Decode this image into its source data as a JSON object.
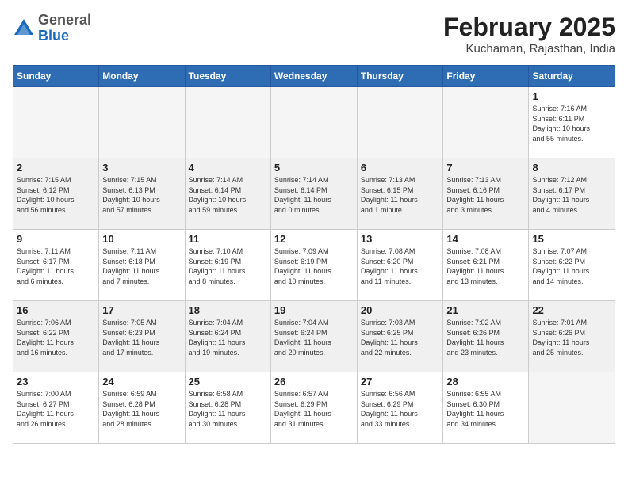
{
  "header": {
    "logo_general": "General",
    "logo_blue": "Blue",
    "title": "February 2025",
    "subtitle": "Kuchaman, Rajasthan, India"
  },
  "weekdays": [
    "Sunday",
    "Monday",
    "Tuesday",
    "Wednesday",
    "Thursday",
    "Friday",
    "Saturday"
  ],
  "weeks": [
    {
      "shaded": false,
      "days": [
        {
          "num": "",
          "info": ""
        },
        {
          "num": "",
          "info": ""
        },
        {
          "num": "",
          "info": ""
        },
        {
          "num": "",
          "info": ""
        },
        {
          "num": "",
          "info": ""
        },
        {
          "num": "",
          "info": ""
        },
        {
          "num": "1",
          "info": "Sunrise: 7:16 AM\nSunset: 6:11 PM\nDaylight: 10 hours\nand 55 minutes."
        }
      ]
    },
    {
      "shaded": true,
      "days": [
        {
          "num": "2",
          "info": "Sunrise: 7:15 AM\nSunset: 6:12 PM\nDaylight: 10 hours\nand 56 minutes."
        },
        {
          "num": "3",
          "info": "Sunrise: 7:15 AM\nSunset: 6:13 PM\nDaylight: 10 hours\nand 57 minutes."
        },
        {
          "num": "4",
          "info": "Sunrise: 7:14 AM\nSunset: 6:14 PM\nDaylight: 10 hours\nand 59 minutes."
        },
        {
          "num": "5",
          "info": "Sunrise: 7:14 AM\nSunset: 6:14 PM\nDaylight: 11 hours\nand 0 minutes."
        },
        {
          "num": "6",
          "info": "Sunrise: 7:13 AM\nSunset: 6:15 PM\nDaylight: 11 hours\nand 1 minute."
        },
        {
          "num": "7",
          "info": "Sunrise: 7:13 AM\nSunset: 6:16 PM\nDaylight: 11 hours\nand 3 minutes."
        },
        {
          "num": "8",
          "info": "Sunrise: 7:12 AM\nSunset: 6:17 PM\nDaylight: 11 hours\nand 4 minutes."
        }
      ]
    },
    {
      "shaded": false,
      "days": [
        {
          "num": "9",
          "info": "Sunrise: 7:11 AM\nSunset: 6:17 PM\nDaylight: 11 hours\nand 6 minutes."
        },
        {
          "num": "10",
          "info": "Sunrise: 7:11 AM\nSunset: 6:18 PM\nDaylight: 11 hours\nand 7 minutes."
        },
        {
          "num": "11",
          "info": "Sunrise: 7:10 AM\nSunset: 6:19 PM\nDaylight: 11 hours\nand 8 minutes."
        },
        {
          "num": "12",
          "info": "Sunrise: 7:09 AM\nSunset: 6:19 PM\nDaylight: 11 hours\nand 10 minutes."
        },
        {
          "num": "13",
          "info": "Sunrise: 7:08 AM\nSunset: 6:20 PM\nDaylight: 11 hours\nand 11 minutes."
        },
        {
          "num": "14",
          "info": "Sunrise: 7:08 AM\nSunset: 6:21 PM\nDaylight: 11 hours\nand 13 minutes."
        },
        {
          "num": "15",
          "info": "Sunrise: 7:07 AM\nSunset: 6:22 PM\nDaylight: 11 hours\nand 14 minutes."
        }
      ]
    },
    {
      "shaded": true,
      "days": [
        {
          "num": "16",
          "info": "Sunrise: 7:06 AM\nSunset: 6:22 PM\nDaylight: 11 hours\nand 16 minutes."
        },
        {
          "num": "17",
          "info": "Sunrise: 7:05 AM\nSunset: 6:23 PM\nDaylight: 11 hours\nand 17 minutes."
        },
        {
          "num": "18",
          "info": "Sunrise: 7:04 AM\nSunset: 6:24 PM\nDaylight: 11 hours\nand 19 minutes."
        },
        {
          "num": "19",
          "info": "Sunrise: 7:04 AM\nSunset: 6:24 PM\nDaylight: 11 hours\nand 20 minutes."
        },
        {
          "num": "20",
          "info": "Sunrise: 7:03 AM\nSunset: 6:25 PM\nDaylight: 11 hours\nand 22 minutes."
        },
        {
          "num": "21",
          "info": "Sunrise: 7:02 AM\nSunset: 6:26 PM\nDaylight: 11 hours\nand 23 minutes."
        },
        {
          "num": "22",
          "info": "Sunrise: 7:01 AM\nSunset: 6:26 PM\nDaylight: 11 hours\nand 25 minutes."
        }
      ]
    },
    {
      "shaded": false,
      "days": [
        {
          "num": "23",
          "info": "Sunrise: 7:00 AM\nSunset: 6:27 PM\nDaylight: 11 hours\nand 26 minutes."
        },
        {
          "num": "24",
          "info": "Sunrise: 6:59 AM\nSunset: 6:28 PM\nDaylight: 11 hours\nand 28 minutes."
        },
        {
          "num": "25",
          "info": "Sunrise: 6:58 AM\nSunset: 6:28 PM\nDaylight: 11 hours\nand 30 minutes."
        },
        {
          "num": "26",
          "info": "Sunrise: 6:57 AM\nSunset: 6:29 PM\nDaylight: 11 hours\nand 31 minutes."
        },
        {
          "num": "27",
          "info": "Sunrise: 6:56 AM\nSunset: 6:29 PM\nDaylight: 11 hours\nand 33 minutes."
        },
        {
          "num": "28",
          "info": "Sunrise: 6:55 AM\nSunset: 6:30 PM\nDaylight: 11 hours\nand 34 minutes."
        },
        {
          "num": "",
          "info": ""
        }
      ]
    }
  ]
}
